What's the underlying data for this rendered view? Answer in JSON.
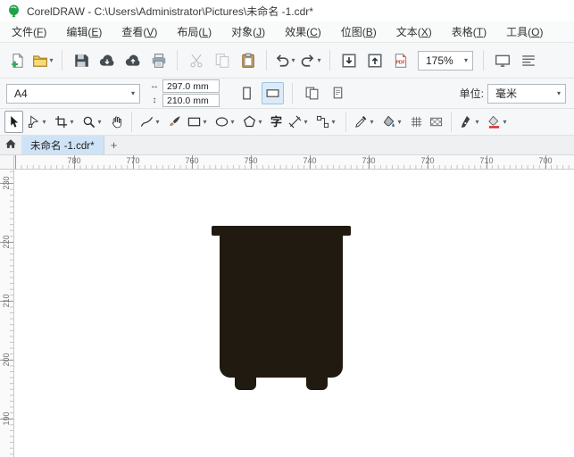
{
  "window": {
    "title": "CorelDRAW - C:\\Users\\Administrator\\Pictures\\未命名 -1.cdr*"
  },
  "menubar": {
    "items": [
      {
        "text": "文件",
        "key": "F"
      },
      {
        "text": "编辑",
        "key": "E"
      },
      {
        "text": "查看",
        "key": "V"
      },
      {
        "text": "布局",
        "key": "L"
      },
      {
        "text": "对象",
        "key": "J"
      },
      {
        "text": "效果",
        "key": "C"
      },
      {
        "text": "位图",
        "key": "B"
      },
      {
        "text": "文本",
        "key": "X"
      },
      {
        "text": "表格",
        "key": "T"
      },
      {
        "text": "工具",
        "key": "O"
      }
    ]
  },
  "standard_toolbar": {
    "zoom_level": "175%",
    "buttons": [
      {
        "name": "new-document",
        "icon": "newdoc"
      },
      {
        "name": "open",
        "icon": "folder",
        "dropdown": true
      },
      {
        "sep": true
      },
      {
        "name": "save",
        "icon": "floppy"
      },
      {
        "name": "open-from-cloud",
        "icon": "cloudDown"
      },
      {
        "name": "save-to-cloud",
        "icon": "cloudUp"
      },
      {
        "name": "print",
        "icon": "printer"
      },
      {
        "sep": true
      },
      {
        "name": "cut",
        "icon": "scissors",
        "disabled": true
      },
      {
        "name": "copy",
        "icon": "copy",
        "disabled": true
      },
      {
        "name": "paste",
        "icon": "paste"
      },
      {
        "sep": true
      },
      {
        "name": "undo",
        "icon": "undo",
        "dropdown": true
      },
      {
        "name": "redo",
        "icon": "redo",
        "dropdown": true
      },
      {
        "sep": true
      },
      {
        "name": "import",
        "icon": "importIc"
      },
      {
        "name": "export",
        "icon": "exportIc"
      },
      {
        "name": "publish-to-pdf",
        "icon": "pdf"
      },
      {
        "zoom": true
      },
      {
        "sep": true
      },
      {
        "name": "full-screen-preview",
        "icon": "fullscreen"
      },
      {
        "name": "show-rulers",
        "icon": "linesIc"
      }
    ]
  },
  "property_bar": {
    "paper_size": "A4",
    "page_width": "297.0 mm",
    "page_height": "210.0 mm",
    "width_glyph": "↔",
    "height_glyph": "↕",
    "units_label": "单位:",
    "units_value": "毫米"
  },
  "toolbox": {
    "text_glyph": "字",
    "tools": [
      {
        "name": "pick",
        "icon": "pick",
        "active": true
      },
      {
        "name": "shape",
        "icon": "shape",
        "dropdown": true
      },
      {
        "name": "crop",
        "icon": "crop",
        "dropdown": true
      },
      {
        "name": "zoom",
        "icon": "zoomIc",
        "dropdown": true
      },
      {
        "name": "pan",
        "icon": "pan"
      },
      {
        "sep": true
      },
      {
        "name": "freehand",
        "icon": "freehand",
        "dropdown": true
      },
      {
        "name": "artistic-media",
        "icon": "brush"
      },
      {
        "name": "rectangle",
        "icon": "rect",
        "dropdown": true
      },
      {
        "name": "ellipse",
        "icon": "ellipseIc",
        "dropdown": true
      },
      {
        "name": "polygon",
        "icon": "polygonIc",
        "dropdown": true
      },
      {
        "name": "text",
        "icon": "text"
      },
      {
        "name": "parallel-dimension",
        "icon": "dimension",
        "dropdown": true
      },
      {
        "name": "connector",
        "icon": "connector",
        "dropdown": true
      },
      {
        "sep": true
      },
      {
        "name": "eyedropper",
        "icon": "eyedropper",
        "dropdown": true
      },
      {
        "name": "interactive-fill",
        "icon": "fillIc",
        "dropdown": true
      },
      {
        "name": "mesh-fill",
        "icon": "mesh"
      },
      {
        "name": "transparency",
        "icon": "transp"
      },
      {
        "sep": true
      },
      {
        "name": "outline-pen",
        "icon": "outlinePen",
        "dropdown": true
      },
      {
        "name": "fill-color",
        "icon": "fillColor",
        "dropdown": true
      }
    ]
  },
  "document_tabs": {
    "active": "未命名 -1.cdr*",
    "new_tab_label": "+"
  },
  "rulers": {
    "horizontal": [
      780,
      770,
      760,
      750,
      740,
      730,
      720,
      710,
      700
    ],
    "vertical": [
      230,
      220,
      210,
      200,
      190
    ]
  },
  "canvas": {
    "object": {
      "name": "container-silhouette",
      "color": "#211a10"
    }
  }
}
